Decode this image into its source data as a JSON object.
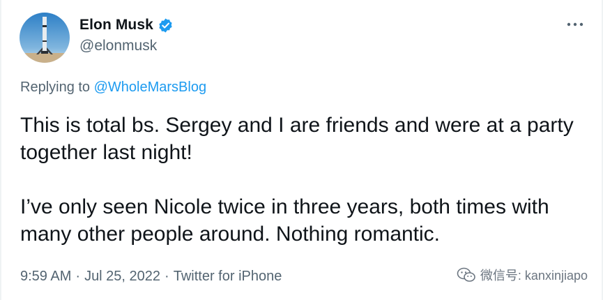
{
  "author": {
    "display_name": "Elon Musk",
    "handle": "@elonmusk",
    "verified": true,
    "avatar_icon": "rocket-avatar-icon"
  },
  "reply": {
    "prefix": "Replying to",
    "mention": "@WholeMarsBlog"
  },
  "tweet": {
    "paragraphs": [
      "This is total bs. Sergey and I are friends and were at a party together last night!",
      "I’ve only seen Nicole twice in three years, both times with many other people around. Nothing romantic."
    ]
  },
  "meta": {
    "time": "9:59 AM",
    "separator": "·",
    "date": "Jul 25, 2022",
    "source": "Twitter for iPhone"
  },
  "watermark": {
    "text": "微信号: kanxinjiapo",
    "icon": "wechat-icon"
  },
  "colors": {
    "text": "#0f1419",
    "secondary": "#536471",
    "link": "#1d9bf0",
    "verified": "#1d9bf0"
  }
}
